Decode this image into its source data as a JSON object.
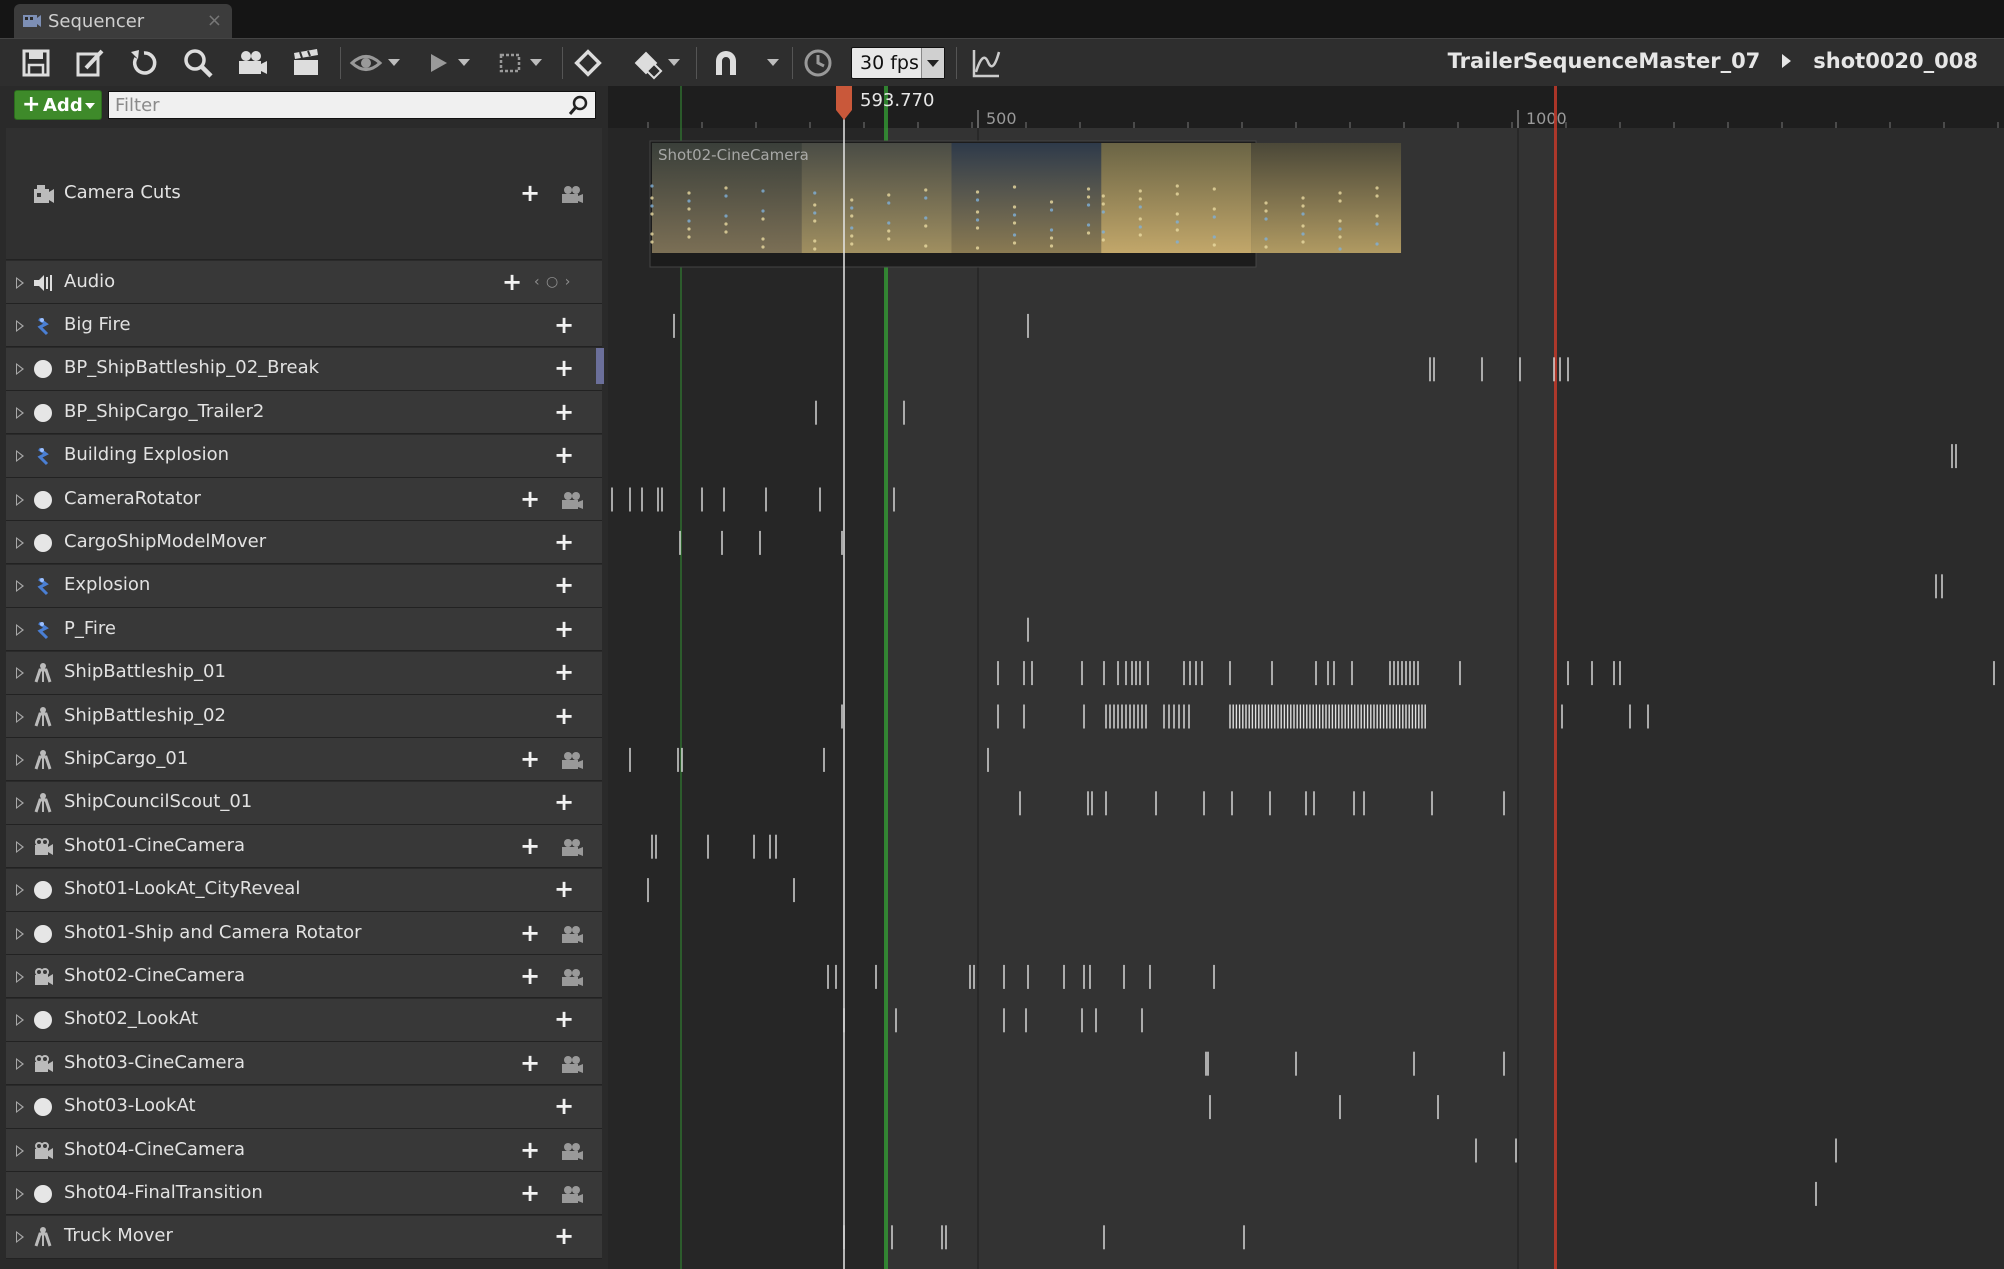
{
  "window": {
    "tab_title": "Sequencer",
    "close_glyph": "×"
  },
  "toolbar": {
    "buttons": [
      "save-icon",
      "save-as-icon",
      "refresh-icon",
      "search-icon",
      "camera-icon",
      "clapper-icon",
      "eye-icon",
      "play-icon",
      "selection-icon",
      "key-icon",
      "key-options-icon",
      "snap-magnet-icon",
      "clock-icon",
      "curve-editor-icon"
    ],
    "fps_value": "30 fps"
  },
  "breadcrumb": {
    "sequence": "TrailerSequenceMaster_07",
    "shot": "shot0020_008"
  },
  "left_panel": {
    "add_label": "Add",
    "add_plus": "+",
    "filter_placeholder": "Filter"
  },
  "timeline": {
    "playhead_value": "593.770",
    "ruler_labels": [
      "500",
      "1000"
    ],
    "camera_cut_section": "Shot02-CineCamera",
    "accent_colors": {
      "start_marker": "#36a336",
      "end_marker": "#c33a2a",
      "playhead": "#c9583a"
    }
  },
  "tracks": [
    {
      "name": "Camera Cuts",
      "icon": "camera-cuts-icon",
      "expandable": false,
      "plus": true,
      "camera": true
    },
    {
      "name": "Audio",
      "icon": "audio-icon",
      "expandable": true,
      "plus": true,
      "camera": false,
      "audio_nav": "‹ ○ ›"
    },
    {
      "name": "Big Fire",
      "icon": "particle-icon",
      "expandable": true,
      "plus": true,
      "camera": false
    },
    {
      "name": "BP_ShipBattleship_02_Break",
      "icon": "sphere-icon",
      "expandable": true,
      "plus": true,
      "camera": false
    },
    {
      "name": "BP_ShipCargo_Trailer2",
      "icon": "sphere-icon",
      "expandable": true,
      "plus": true,
      "camera": false
    },
    {
      "name": "Building Explosion",
      "icon": "particle-icon",
      "expandable": true,
      "plus": true,
      "camera": false
    },
    {
      "name": "CameraRotator",
      "icon": "sphere-icon",
      "expandable": true,
      "plus": true,
      "camera": true
    },
    {
      "name": "CargoShipModelMover",
      "icon": "sphere-icon",
      "expandable": true,
      "plus": true,
      "camera": false
    },
    {
      "name": "Explosion",
      "icon": "particle-icon",
      "expandable": true,
      "plus": true,
      "camera": false
    },
    {
      "name": "P_Fire",
      "icon": "particle-icon",
      "expandable": true,
      "plus": true,
      "camera": false
    },
    {
      "name": "ShipBattleship_01",
      "icon": "skeletal-mesh-icon",
      "expandable": true,
      "plus": true,
      "camera": false
    },
    {
      "name": "ShipBattleship_02",
      "icon": "skeletal-mesh-icon",
      "expandable": true,
      "plus": true,
      "camera": false
    },
    {
      "name": "ShipCargo_01",
      "icon": "skeletal-mesh-icon",
      "expandable": true,
      "plus": true,
      "camera": true
    },
    {
      "name": "ShipCouncilScout_01",
      "icon": "skeletal-mesh-icon",
      "expandable": true,
      "plus": true,
      "camera": false
    },
    {
      "name": "Shot01-CineCamera",
      "icon": "cine-camera-icon",
      "expandable": true,
      "plus": true,
      "camera": true
    },
    {
      "name": "Shot01-LookAt_CityReveal",
      "icon": "sphere-icon",
      "expandable": true,
      "plus": true,
      "camera": false
    },
    {
      "name": "Shot01-Ship and Camera Rotator",
      "icon": "sphere-icon",
      "expandable": true,
      "plus": true,
      "camera": true
    },
    {
      "name": "Shot02-CineCamera",
      "icon": "cine-camera-icon",
      "expandable": true,
      "plus": true,
      "camera": true
    },
    {
      "name": "Shot02_LookAt",
      "icon": "sphere-icon",
      "expandable": true,
      "plus": true,
      "camera": false
    },
    {
      "name": "Shot03-CineCamera",
      "icon": "cine-camera-icon",
      "expandable": true,
      "plus": true,
      "camera": true
    },
    {
      "name": "Shot03-LookAt",
      "icon": "sphere-icon",
      "expandable": true,
      "plus": true,
      "camera": false
    },
    {
      "name": "Shot04-CineCamera",
      "icon": "cine-camera-icon",
      "expandable": true,
      "plus": true,
      "camera": true
    },
    {
      "name": "Shot04-FinalTransition",
      "icon": "sphere-icon",
      "expandable": true,
      "plus": true,
      "camera": true
    },
    {
      "name": "Truck Mover",
      "icon": "skeletal-mesh-icon",
      "expandable": true,
      "plus": true,
      "camera": false
    }
  ]
}
